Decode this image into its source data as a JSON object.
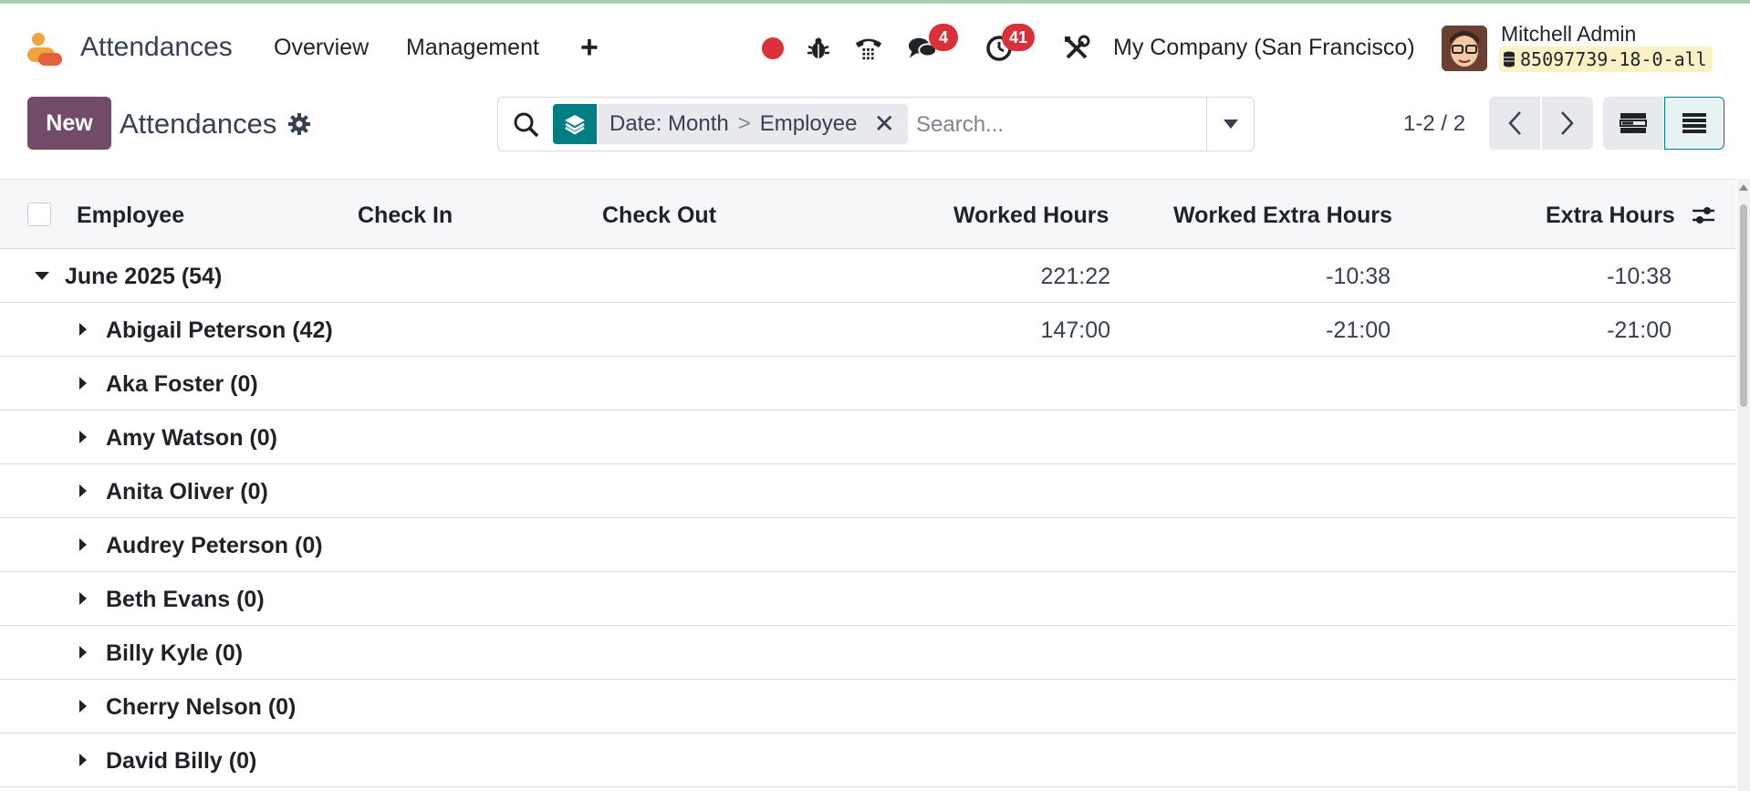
{
  "navbar": {
    "app_title": "Attendances",
    "menu": [
      "Overview",
      "Management"
    ],
    "plus": "+",
    "messages_count": "4",
    "activities_count": "41",
    "company": "My Company (San Francisco)",
    "user_name": "Mitchell Admin",
    "db_name": "85097739-18-0-all"
  },
  "control": {
    "new_label": "New",
    "title": "Attendances",
    "facet_group": "Date: Month",
    "facet_sep": ">",
    "facet_sub": "Employee",
    "search_placeholder": "Search...",
    "pager": "1-2 / 2"
  },
  "list": {
    "columns": [
      "Employee",
      "Check In",
      "Check Out",
      "Worked Hours",
      "Worked Extra Hours",
      "Extra Hours"
    ],
    "group": {
      "label": "June 2025 (54)",
      "worked_hours": "221:22",
      "worked_extra_hours": "-10:38",
      "extra_hours": "-10:38"
    },
    "rows": [
      {
        "label": "Abigail Peterson (42)",
        "worked_hours": "147:00",
        "worked_extra_hours": "-21:00",
        "extra_hours": "-21:00"
      },
      {
        "label": "Aka Foster (0)",
        "worked_hours": "",
        "worked_extra_hours": "",
        "extra_hours": ""
      },
      {
        "label": "Amy Watson (0)",
        "worked_hours": "",
        "worked_extra_hours": "",
        "extra_hours": ""
      },
      {
        "label": "Anita Oliver (0)",
        "worked_hours": "",
        "worked_extra_hours": "",
        "extra_hours": ""
      },
      {
        "label": "Audrey Peterson (0)",
        "worked_hours": "",
        "worked_extra_hours": "",
        "extra_hours": ""
      },
      {
        "label": "Beth Evans (0)",
        "worked_hours": "",
        "worked_extra_hours": "",
        "extra_hours": ""
      },
      {
        "label": "Billy Kyle (0)",
        "worked_hours": "",
        "worked_extra_hours": "",
        "extra_hours": ""
      },
      {
        "label": "Cherry Nelson (0)",
        "worked_hours": "",
        "worked_extra_hours": "",
        "extra_hours": ""
      },
      {
        "label": "David Billy (0)",
        "worked_hours": "",
        "worked_extra_hours": "",
        "extra_hours": ""
      }
    ]
  },
  "colors": {
    "brand": "#714b67",
    "accent": "#017e84",
    "badge": "#d9303a"
  },
  "icons": [
    "app-logo",
    "record-icon",
    "bug-icon",
    "phone-icon",
    "chat-icon",
    "clock-icon",
    "tools-icon",
    "database-icon",
    "gear-icon",
    "search-icon",
    "layers-icon",
    "close-icon",
    "caret-down-icon",
    "chevron-left-icon",
    "chevron-right-icon",
    "kanban-view-icon",
    "list-view-icon",
    "column-options-icon"
  ]
}
